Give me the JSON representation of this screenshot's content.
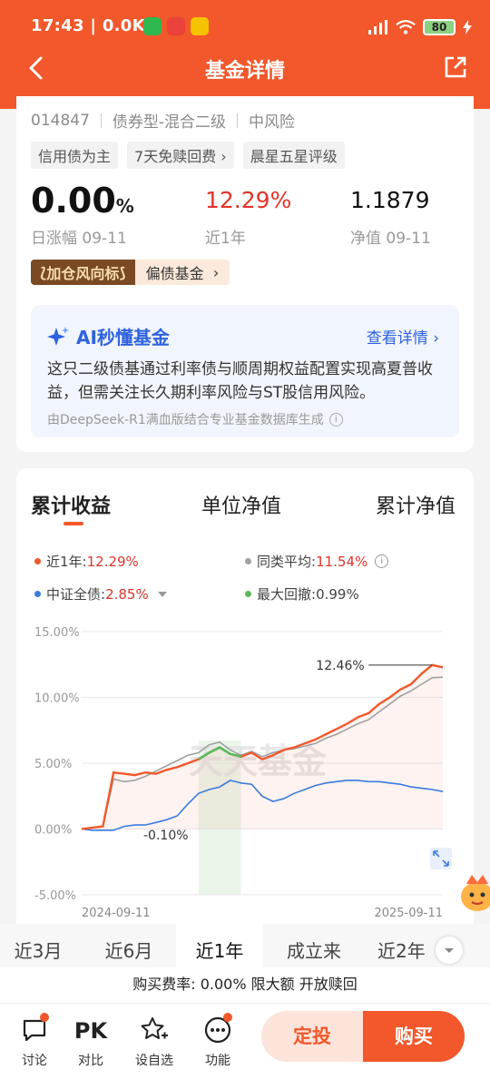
{
  "status": {
    "time": "17:43",
    "speed": "0.0K/s",
    "battery": "80"
  },
  "nav": {
    "title": "基金详情"
  },
  "fund": {
    "code": "014847",
    "type": "债券型-混合二级",
    "risk": "中风险",
    "tags": [
      "信用债为主",
      "7天免赎回费 ›",
      "晨星五星评级"
    ],
    "daily_change": "0.00",
    "daily_unit": "%",
    "daily_label": "日涨幅 09-11",
    "year_return": "12.29%",
    "year_label": "近1年",
    "nav_value": "1.1879",
    "nav_label": "净值 09-11",
    "badge_left": "加仓风向标",
    "badge_right": "偏债基金",
    "badge_arrow": "›"
  },
  "ai": {
    "title": "AI秒懂基金",
    "more": "查看详情 ›",
    "text": "这只二级债基通过利率债与顺周期权益配置实现高夏普收益，但需关注长久期利率风险与ST股信用风险。",
    "footer": "由DeepSeek-R1满血版结合专业基金数据库生成",
    "info": "i"
  },
  "chart_tabs": [
    "累计收益",
    "单位净值",
    "累计净值"
  ],
  "legend": {
    "l1_label": "近1年:",
    "l1_value": "12.29%",
    "l2_label": "同类平均:",
    "l2_value": "11.54%",
    "l3_label": "中证全债:",
    "l3_value": "2.85%",
    "l4_label": "最大回撤:",
    "l4_value": "0.99%",
    "colors": {
      "fund": "#f2582b",
      "peer": "#a0a0a0",
      "index": "#3a7be0",
      "drawdown": "#5cb85c"
    }
  },
  "chart_data": {
    "type": "line",
    "ylim": [
      -5,
      15
    ],
    "yticks": [
      "15.00%",
      "10.00%",
      "5.00%",
      "0.00%",
      "-5.00%"
    ],
    "x_start": "2024-09-11",
    "x_end": "2025-09-11",
    "annotation_max": "12.46%",
    "annotation_min": "-0.10%",
    "watermark": "天天基金",
    "series": [
      {
        "name": "近1年",
        "color": "#f2582b",
        "values": [
          0.0,
          0.1,
          0.2,
          4.3,
          4.2,
          4.1,
          4.3,
          4.2,
          4.5,
          4.7,
          5.0,
          5.3,
          5.8,
          6.2,
          5.7,
          5.5,
          5.8,
          5.3,
          5.6,
          6.0,
          6.2,
          6.5,
          6.8,
          7.2,
          7.6,
          8.0,
          8.5,
          8.8,
          9.5,
          10.0,
          10.6,
          11.0,
          11.8,
          12.46,
          12.29
        ]
      },
      {
        "name": "同类平均",
        "color": "#a0a0a0",
        "values": [
          0.0,
          0.1,
          0.2,
          3.8,
          3.6,
          3.7,
          4.0,
          4.4,
          4.8,
          5.2,
          5.6,
          5.8,
          6.4,
          6.6,
          6.0,
          5.6,
          5.9,
          5.5,
          5.8,
          6.0,
          6.1,
          6.3,
          6.5,
          6.9,
          7.2,
          7.6,
          8.0,
          8.3,
          8.9,
          9.5,
          10.1,
          10.5,
          11.0,
          11.5,
          11.54
        ]
      },
      {
        "name": "中证全债",
        "color": "#3a7be0",
        "values": [
          0.0,
          -0.1,
          -0.1,
          -0.1,
          0.2,
          0.3,
          0.3,
          0.5,
          0.7,
          1.0,
          1.9,
          2.7,
          3.0,
          3.2,
          3.7,
          3.5,
          3.4,
          2.5,
          2.1,
          2.3,
          2.7,
          3.0,
          3.3,
          3.5,
          3.6,
          3.7,
          3.7,
          3.6,
          3.6,
          3.5,
          3.4,
          3.2,
          3.1,
          3.0,
          2.85
        ]
      }
    ],
    "drawdown_window": [
      11,
      15
    ]
  },
  "periods": [
    "近3月",
    "近6月",
    "近1年",
    "成立来",
    "近2年"
  ],
  "fee_text": "购买费率: 0.00% 限大额 开放赎回",
  "bottom": {
    "items": [
      "讨论",
      "对比",
      "设自选",
      "功能"
    ],
    "pk": "PK",
    "fixed_invest": "定投",
    "buy": "购买"
  }
}
